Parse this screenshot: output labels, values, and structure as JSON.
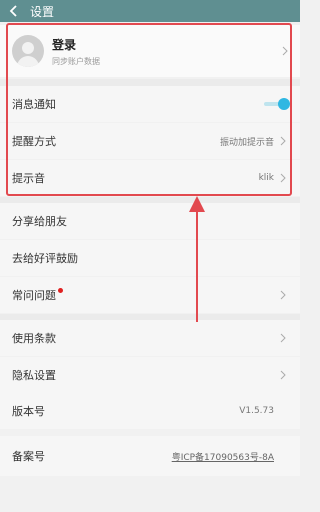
{
  "header": {
    "title": "设置",
    "back_icon": "chevron-left-icon"
  },
  "account": {
    "title": "登录",
    "subtitle": "同步账户数据"
  },
  "settings": {
    "notification": {
      "label": "消息通知",
      "enabled": true
    },
    "reminder_mode": {
      "label": "提醒方式",
      "value": "振动加提示音"
    },
    "ringtone": {
      "label": "提示音",
      "value": "klik"
    },
    "share": {
      "label": "分享给朋友"
    },
    "rate": {
      "label": "去给好评鼓励"
    },
    "faq": {
      "label": "常问问题"
    },
    "terms": {
      "label": "使用条款"
    },
    "privacy": {
      "label": "隐私设置"
    },
    "version": {
      "label": "版本号",
      "value": "V1.5.73"
    },
    "icp": {
      "label": "备案号",
      "value": "粤ICP备17090563号-8A"
    }
  },
  "colors": {
    "header_bg": "#5f8f91",
    "toggle_on": "#2fb7e2",
    "annotation": "#e2494f",
    "badge": "#e02020"
  }
}
